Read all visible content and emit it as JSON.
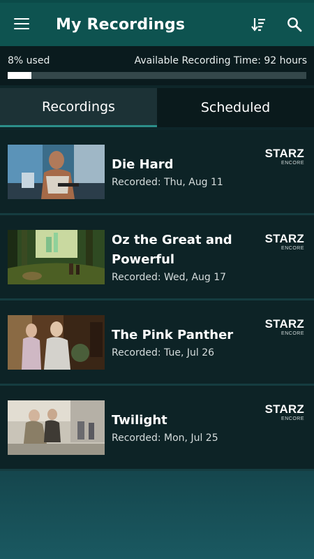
{
  "header": {
    "title": "My Recordings",
    "menu_icon": "hamburger-menu-icon",
    "sort_icon": "sort-descending-icon",
    "search_icon": "search-icon"
  },
  "usage": {
    "used_label": "8% used",
    "used_fraction": 0.08,
    "available_label": "Available Recording Time: 92 hours"
  },
  "tabs": [
    {
      "label": "Recordings",
      "active": true
    },
    {
      "label": "Scheduled",
      "active": false
    }
  ],
  "recordings": [
    {
      "title": "Die Hard",
      "date": "Recorded: Thu, Aug 11",
      "network": "STARZ",
      "network_sub": "ENCORE"
    },
    {
      "title": "Oz the Great and Powerful",
      "date": "Recorded: Wed, Aug 17",
      "network": "STARZ",
      "network_sub": "ENCORE"
    },
    {
      "title": "The Pink Panther",
      "date": "Recorded: Tue, Jul 26",
      "network": "STARZ",
      "network_sub": "ENCORE"
    },
    {
      "title": "Twilight",
      "date": "Recorded: Mon, Jul 25",
      "network": "STARZ",
      "network_sub": "ENCORE"
    }
  ],
  "colors": {
    "appbar": "#0e5350",
    "accent": "#2c8f8a",
    "background": "#0d2326"
  }
}
